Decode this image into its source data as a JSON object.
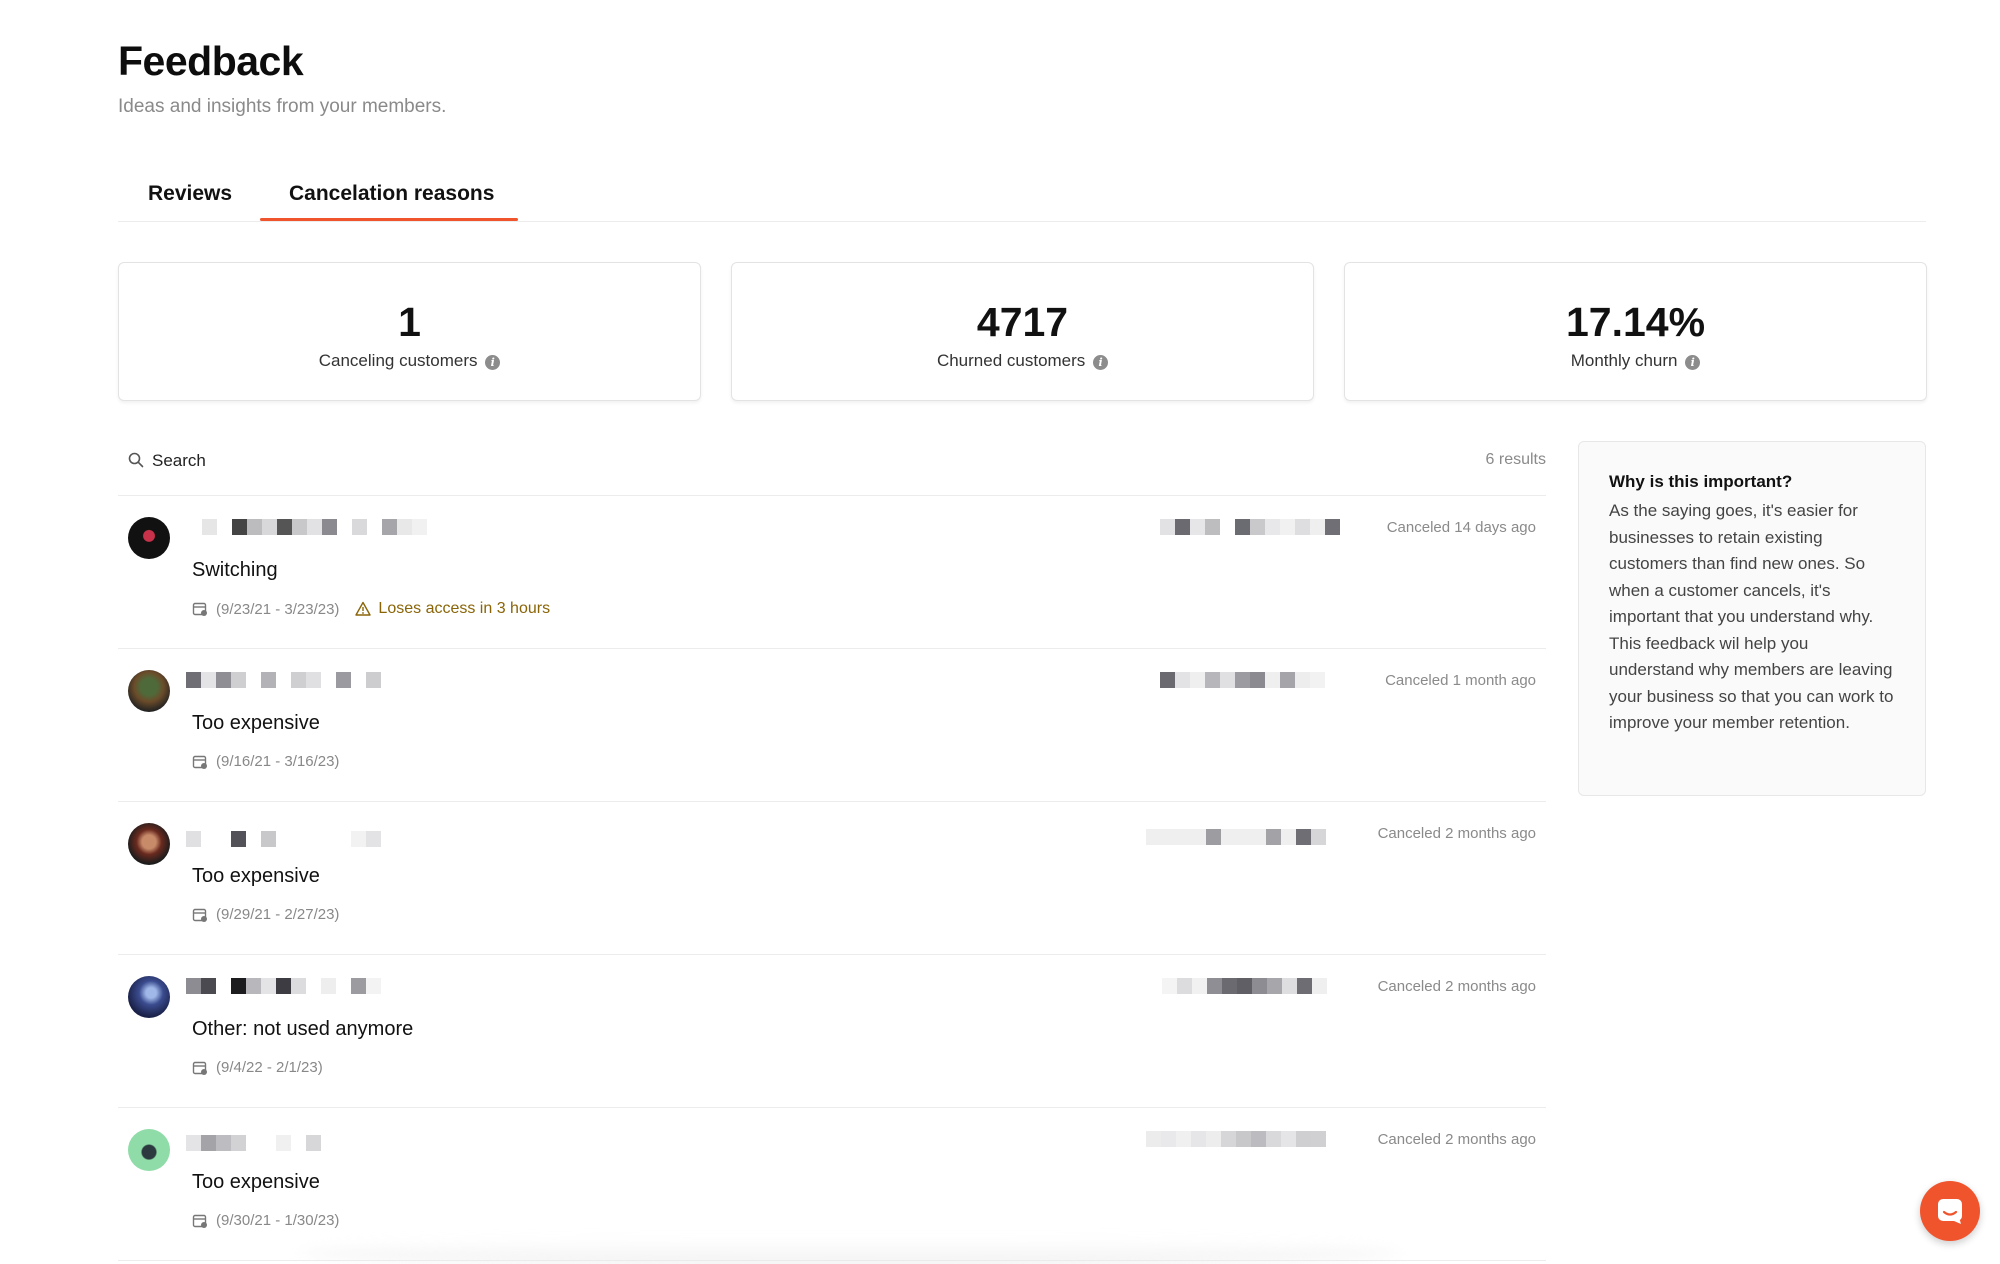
{
  "header": {
    "title": "Feedback",
    "subtitle": "Ideas and insights from your members."
  },
  "tabs": [
    {
      "label": "Reviews",
      "active": false
    },
    {
      "label": "Cancelation reasons",
      "active": true
    }
  ],
  "stats": [
    {
      "value": "1",
      "label": "Canceling customers"
    },
    {
      "value": "4717",
      "label": "Churned customers"
    },
    {
      "value": "17.14%",
      "label": "Monthly churn"
    }
  ],
  "search": {
    "placeholder": "Search",
    "results": "6 results"
  },
  "rows": [
    {
      "reason": "Switching",
      "dates": "(9/23/21 - 3/23/23)",
      "warning": "Loses access in 3 hours",
      "canceled": "Canceled 14 days ago"
    },
    {
      "reason": "Too expensive",
      "dates": "(9/16/21 - 3/16/23)",
      "warning": "",
      "canceled": "Canceled 1 month ago"
    },
    {
      "reason": "Too expensive",
      "dates": "(9/29/21 - 2/27/23)",
      "warning": "",
      "canceled": "Canceled 2 months ago"
    },
    {
      "reason": "Other: not used anymore",
      "dates": "(9/4/22 - 2/1/23)",
      "warning": "",
      "canceled": "Canceled 2 months ago"
    },
    {
      "reason": "Too expensive",
      "dates": "(9/30/21 - 1/30/23)",
      "warning": "",
      "canceled": "Canceled 2 months ago"
    }
  ],
  "why": {
    "title": "Why is this important?",
    "body": "As the saying goes, it's easier for businesses to retain existing customers than find new ones. So when a customer cancels, it's important that you understand why. This feedback wil help you understand why members are leaving your business so that you can work to improve your member retention."
  },
  "colors": {
    "accent": "#f0542d",
    "warning": "#8a6508"
  }
}
